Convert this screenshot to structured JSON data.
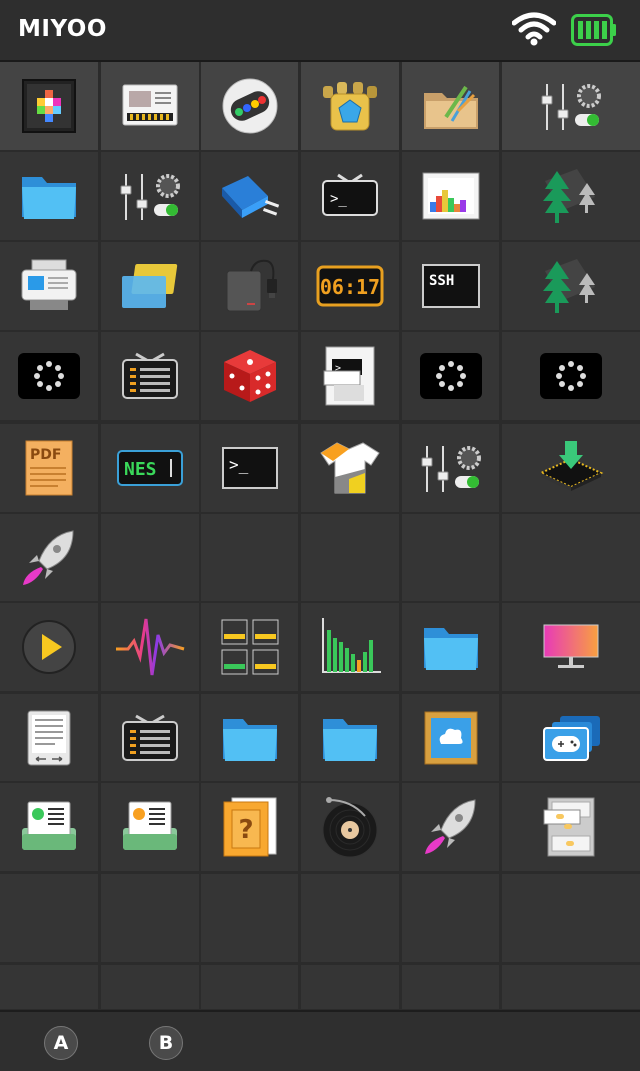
{
  "header": {
    "title": "MIYOO"
  },
  "status": {
    "wifi_icon": "wifi-icon",
    "battery_icon": "battery-full-icon",
    "battery_color": "#3cd04a"
  },
  "buttons": {
    "a_label": "A",
    "b_label": "B"
  },
  "icons": {
    "clock_text": "06:17",
    "ssh_text": "SSH",
    "pdf_text": "PDF",
    "nes_text": "NES",
    "terminal_prompt": ">_",
    "help_text": "?"
  },
  "grid_icons": [
    [
      "pixel-art-icon",
      "rom-card-icon",
      "gamepad-icon",
      "gem-gold-icon",
      "folder-brush-icon",
      "settings-sliders-icon"
    ],
    [
      "folder-blue-icon",
      "settings-sliders-icon",
      "usb-adapter-icon",
      "terminal-tv-icon",
      "palette-chart-icon",
      "trees-arrows-icon"
    ],
    [
      "printer-icon",
      "cards-icon",
      "charger-icon",
      "clock-display-icon",
      "ssh-terminal-icon",
      "trees-arrows-icon"
    ],
    [
      "loading-dots-icon",
      "tv-list-icon",
      "red-dice-icon",
      "terminal-window-icon",
      "loading-dots-icon",
      "loading-dots-icon"
    ],
    [
      "pdf-document-icon",
      "nes-icon",
      "terminal-icon",
      "tshirt-icon",
      "settings-sliders-icon",
      "chip-download-icon"
    ],
    [
      "rocket-icon",
      "",
      "",
      "",
      "",
      ""
    ],
    [
      "play-button-icon",
      "heartbeat-icon",
      "list-blocks-icon",
      "bar-chart-icon",
      "folder-blue-icon",
      "monitor-gradient-icon"
    ],
    [
      "ereader-icon",
      "tv-list-icon",
      "folder-blue-icon",
      "folder-blue-icon",
      "picture-frame-icon",
      "game-controller-cards-icon"
    ],
    [
      "contact-green-icon",
      "contact-orange-icon",
      "help-book-icon",
      "vinyl-record-icon",
      "rocket-icon",
      "pill-box-icon"
    ],
    [
      "",
      "",
      "",
      "",
      "",
      ""
    ],
    [
      "",
      "",
      "",
      "",
      "",
      ""
    ]
  ]
}
